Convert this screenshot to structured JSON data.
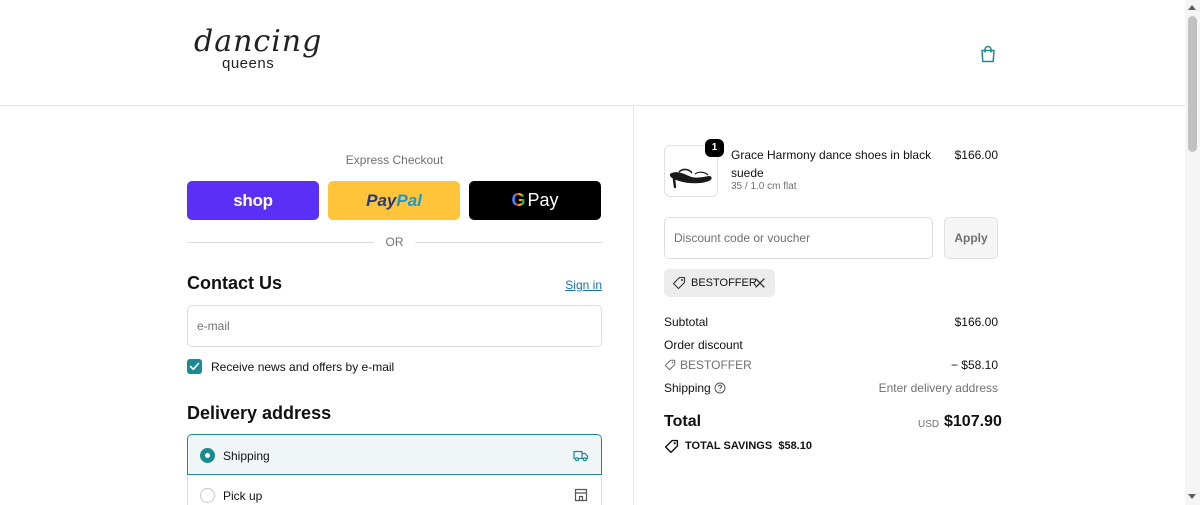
{
  "brand": {
    "logo_script": "dancing",
    "logo_sub": "queens"
  },
  "header": {
    "cart_icon": "shopping-bag-icon"
  },
  "express": {
    "title": "Express Checkout",
    "shop_label": "shop",
    "paypal_label_1": "Pay",
    "paypal_label_2": "Pal",
    "gpay_g": "G",
    "gpay_label": "Pay",
    "or_label": "OR"
  },
  "contact": {
    "title": "Contact Us",
    "signin_label": "Sign in",
    "email_placeholder": "e-mail",
    "newsletter_label": "Receive news and offers by e-mail",
    "newsletter_checked": true
  },
  "delivery": {
    "title": "Delivery address",
    "options": [
      {
        "label": "Shipping",
        "selected": true,
        "icon": "truck-icon"
      },
      {
        "label": "Pick up",
        "selected": false,
        "icon": "store-icon"
      }
    ]
  },
  "cart": {
    "items": [
      {
        "quantity": "1",
        "name": "Grace Harmony dance shoes in black suede",
        "variant": "35 / 1.0 cm flat",
        "price": "$166.00"
      }
    ]
  },
  "discount": {
    "placeholder": "Discount code or voucher",
    "apply_label": "Apply",
    "applied_code": "BESTOFFER"
  },
  "summary": {
    "subtotal_label": "Subtotal",
    "subtotal_value": "$166.00",
    "order_discount_label": "Order discount",
    "discount_code": "BESTOFFER",
    "discount_value": "− $58.10",
    "shipping_label": "Shipping",
    "shipping_value": "Enter delivery address",
    "total_label": "Total",
    "total_currency": "USD",
    "total_value": "$107.90",
    "savings_label": "TOTAL SAVINGS",
    "savings_value": "$58.10"
  },
  "colors": {
    "accent": "#1b8a92",
    "shop_pay": "#5a31f4",
    "paypal": "#ffc439",
    "link": "#1773b0"
  }
}
